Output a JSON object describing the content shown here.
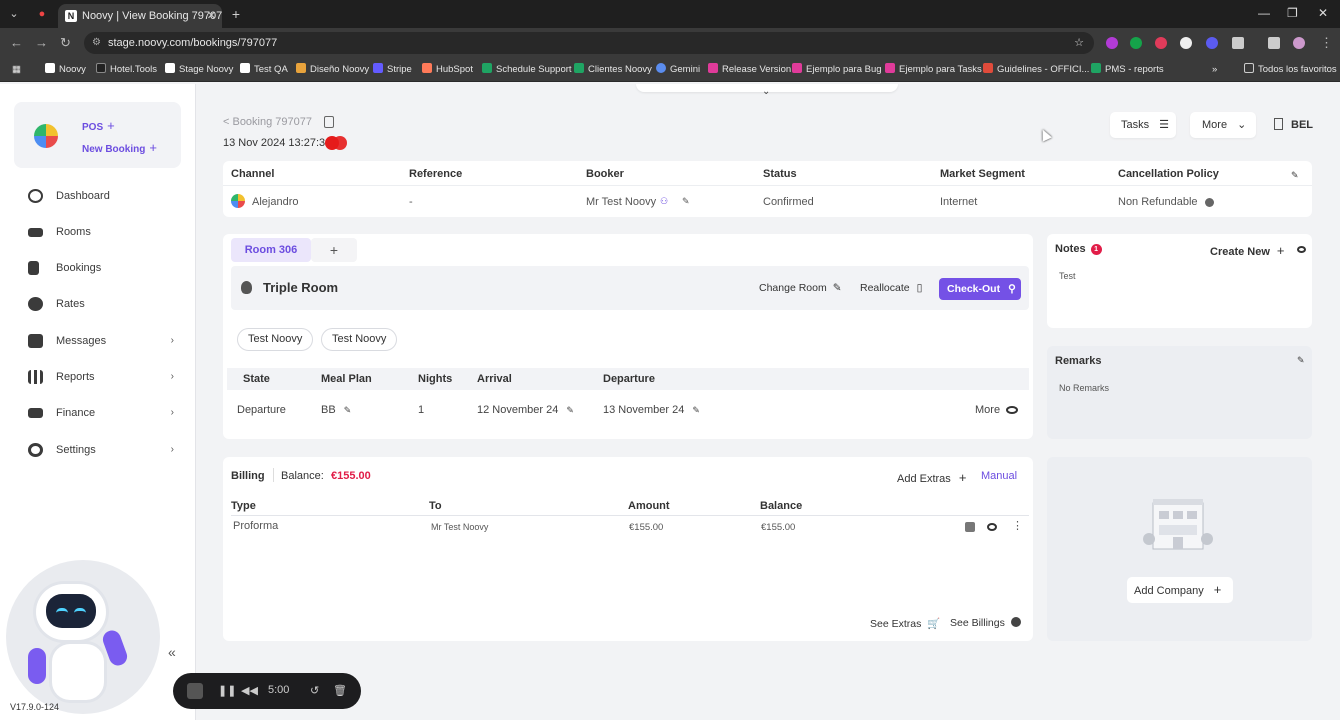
{
  "browser": {
    "tab_title": "Noovy | View Booking 797077",
    "url": "stage.noovy.com/bookings/797077",
    "bookmarks": [
      "Noovy",
      "Hotel.Tools",
      "Stage Noovy",
      "Test QA",
      "Diseño Noovy",
      "Stripe",
      "HubSpot",
      "Schedule Support",
      "Clientes Noovy",
      "Gemini",
      "Release Version",
      "Ejemplo para Bug",
      "Ejemplo para Tasks",
      "Guidelines - OFFICI...",
      "PMS - reports"
    ],
    "all_bookmarks": "Todos los favoritos"
  },
  "sidebar": {
    "pos": "POS",
    "new_booking": "New Booking",
    "items": [
      {
        "label": "Dashboard"
      },
      {
        "label": "Rooms"
      },
      {
        "label": "Bookings"
      },
      {
        "label": "Rates"
      },
      {
        "label": "Messages"
      },
      {
        "label": "Reports"
      },
      {
        "label": "Finance"
      },
      {
        "label": "Settings"
      }
    ],
    "version": "V17.9.0-124"
  },
  "recorder": {
    "time": "5:00"
  },
  "header": {
    "back_link": "< Booking 797077",
    "date": "13 Nov 2024 13:27:32",
    "tasks": "Tasks",
    "more": "More",
    "property": "BEL"
  },
  "info": {
    "headers": [
      "Channel",
      "Reference",
      "Booker",
      "Status",
      "Market Segment",
      "Cancellation Policy"
    ],
    "values": [
      "Alejandro",
      "-",
      "Mr Test Noovy",
      "Confirmed",
      "Internet",
      "Non Refundable"
    ]
  },
  "room": {
    "tab": "Room 306",
    "type": "Triple Room",
    "change_room": "Change Room",
    "reallocate": "Reallocate",
    "checkout": "Check-Out",
    "guests": [
      "Test Noovy",
      "Test Noovy"
    ],
    "headers": [
      "State",
      "Meal Plan",
      "Nights",
      "Arrival",
      "Departure"
    ],
    "row": {
      "state": "Departure",
      "meal_plan": "BB",
      "nights": "1",
      "arrival": "12 November 24",
      "departure": "13 November 24"
    },
    "more": "More"
  },
  "billing": {
    "title": "Billing",
    "balance_label": "Balance:",
    "balance_value": "€155.00",
    "add_extras": "Add Extras",
    "manual": "Manual",
    "headers": [
      "Type",
      "To",
      "Amount",
      "Balance"
    ],
    "row": {
      "type": "Proforma",
      "to": "Mr Test Noovy",
      "amount": "€155.00",
      "balance": "€155.00"
    },
    "see_extras": "See Extras",
    "see_billings": "See Billings"
  },
  "notes": {
    "title": "Notes",
    "count": "1",
    "create_new": "Create New",
    "text": "Test"
  },
  "remarks": {
    "title": "Remarks",
    "text": "No Remarks"
  },
  "company": {
    "add": "Add Company"
  },
  "colors": {
    "accent": "#7451e6",
    "danger": "#e11d48"
  }
}
